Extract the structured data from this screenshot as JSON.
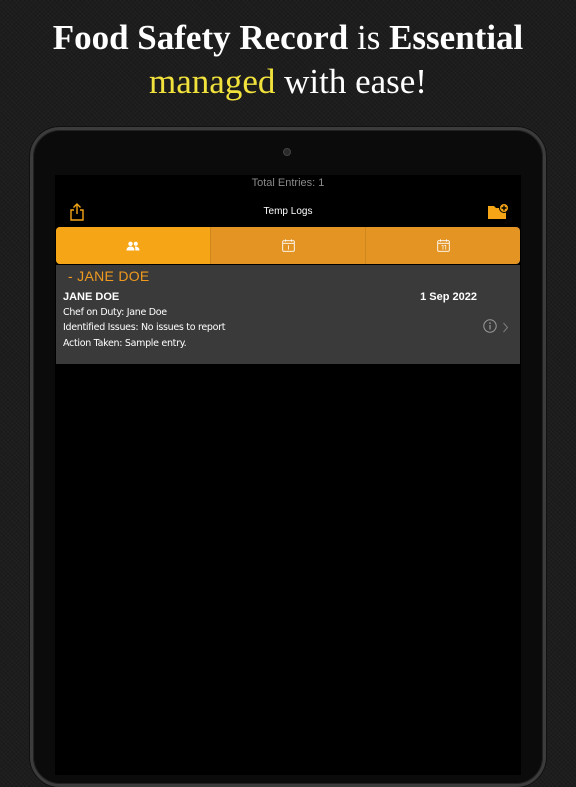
{
  "headline": {
    "line1_bold_a": "Food Safety Record",
    "line1_mid": " is ",
    "line1_bold_b": "Essential",
    "line2_accent": "managed",
    "line2_rest": " with ease!"
  },
  "app": {
    "total_entries": "Total Entries: 1",
    "title": "Temp Logs",
    "accent_color": "#f5a516",
    "tabs": [
      {
        "icon": "people-icon",
        "active": true
      },
      {
        "icon": "calendar-icon",
        "active": false
      },
      {
        "icon": "calendar-icon",
        "active": false
      }
    ]
  },
  "records": [
    {
      "group": "-   JANE DOE",
      "name": "JANE DOE",
      "date": "1 Sep 2022",
      "chef": "Chef on Duty: Jane Doe",
      "issues": "Identified Issues: No issues to report",
      "action": "Action Taken: Sample entry."
    }
  ]
}
